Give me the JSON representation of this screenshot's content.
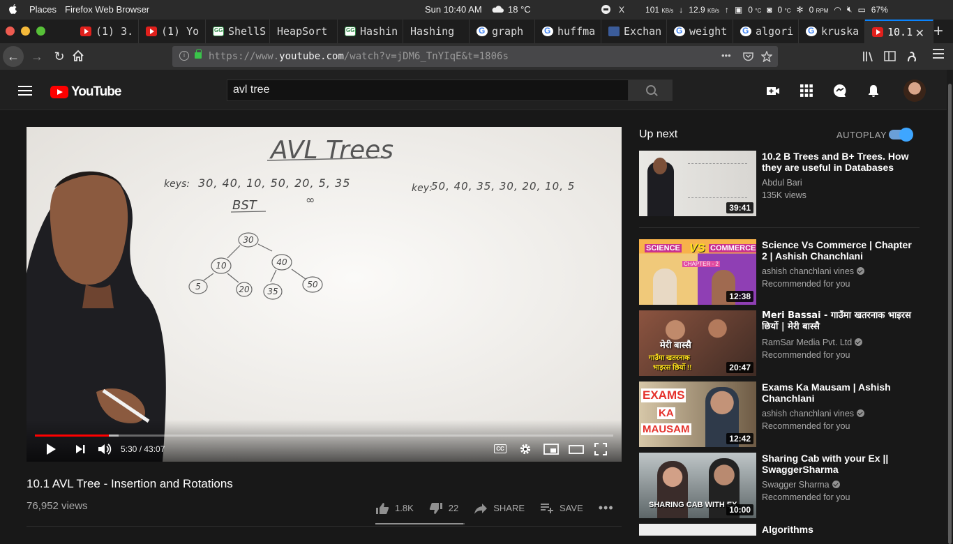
{
  "os": {
    "places": "Places",
    "app_name": "Firefox Web Browser",
    "clock": "Sun 10:40 AM",
    "weather": "18 °C",
    "status": {
      "x": "X",
      "net_down": "101",
      "net_down_unit": "KB/s",
      "net_up": "12.9",
      "net_up_unit": "KB/s",
      "cpu_temp": "0",
      "cpu_temp_unit": "°C",
      "gpu_temp": "0",
      "gpu_temp_unit": "°C",
      "fan": "0",
      "fan_unit": "RPM",
      "battery": "67%"
    }
  },
  "tabs": [
    {
      "label": "(1) 3.",
      "icon": "youtube-icon"
    },
    {
      "label": "(1) Yo",
      "icon": "youtube-icon"
    },
    {
      "label": "ShellS",
      "icon": "geeksforgeeks-icon"
    },
    {
      "label": "HeapSort",
      "icon": "none"
    },
    {
      "label": "Hashin",
      "icon": "geeksforgeeks-icon"
    },
    {
      "label": "Hashing",
      "icon": "none"
    },
    {
      "label": "graph",
      "icon": "google-icon"
    },
    {
      "label": "huffma",
      "icon": "google-icon"
    },
    {
      "label": "Exchan",
      "icon": "stackexchange-icon"
    },
    {
      "label": "weight",
      "icon": "google-icon"
    },
    {
      "label": "algori",
      "icon": "google-icon"
    },
    {
      "label": "kruska",
      "icon": "google-icon"
    },
    {
      "label": "10.1",
      "icon": "youtube-icon"
    }
  ],
  "nav": {
    "url_prefix": "https://www.",
    "url_domain": "youtube.com",
    "url_path": "/watch?v=jDM6_TnYIqE&t=1806s",
    "more": "•••"
  },
  "youtube": {
    "logo_text": "YouTube",
    "search_value": "avl tree"
  },
  "video": {
    "current_time": "5:30",
    "duration": "43:07",
    "progress_fraction": 0.128,
    "buffered_fraction": 0.145,
    "cc": "CC",
    "board": {
      "title": "AVL Trees",
      "keys_label": "keys:",
      "keys": "30, 40, 10, 50, 20, 5, 35",
      "bst_label": "BST",
      "right_keys_label": "key:",
      "right_keys": "50, 40, 35, 30, 20, 10, 5",
      "nodes": [
        "30",
        "10",
        "40",
        "5",
        "20",
        "35",
        "50"
      ],
      "scribble": "∞"
    }
  },
  "info": {
    "title": "10.1 AVL Tree - Insertion and Rotations",
    "views": "76,952 views",
    "likes": "1.8K",
    "dislikes": "22",
    "like_fraction": 0.988,
    "share": "SHARE",
    "save": "SAVE"
  },
  "sidebar": {
    "up_next": "Up next",
    "autoplay": "AUTOPLAY",
    "autoplay_on": true,
    "items": [
      {
        "title": "10.2 B Trees and B+ Trees. How they are useful in Databases",
        "channel": "Abdul Bari",
        "meta": "135K views",
        "duration": "39:41",
        "verified": false
      },
      {
        "title": "Science Vs Commerce | Chapter 2 | Ashish Chanchlani",
        "channel": "ashish chanchlani vines",
        "meta": "Recommended for you",
        "duration": "12:38",
        "verified": true,
        "thumb_text": [
          "SCIENCE",
          "VS",
          "COMMERCE",
          "CHAPTER - 2"
        ]
      },
      {
        "title": "Meri Bassai - गाउँमा खतरनाक भाइरस छिर्यो | मेरी बास्सै",
        "channel": "RamSar Media Pvt. Ltd",
        "meta": "Recommended for you",
        "duration": "20:47",
        "verified": true,
        "thumb_text": [
          "मेरी बास्सै",
          "गाउँमा खतरनाक",
          "भाइरस छिर्यो !!"
        ]
      },
      {
        "title": "Exams Ka Mausam | Ashish Chanchlani",
        "channel": "ashish chanchlani vines",
        "meta": "Recommended for you",
        "duration": "12:42",
        "verified": true,
        "thumb_text": [
          "EXAMS",
          "KA",
          "MAUSAM"
        ]
      },
      {
        "title": "Sharing Cab with your Ex || SwaggerSharma",
        "channel": "Swagger Sharma",
        "meta": "Recommended for you",
        "duration": "10:00",
        "verified": true,
        "thumb_text": [
          "SHARING CAB WITH EX"
        ]
      },
      {
        "title": "Algorithms",
        "channel": "",
        "meta": "",
        "duration": "",
        "verified": false
      }
    ]
  }
}
